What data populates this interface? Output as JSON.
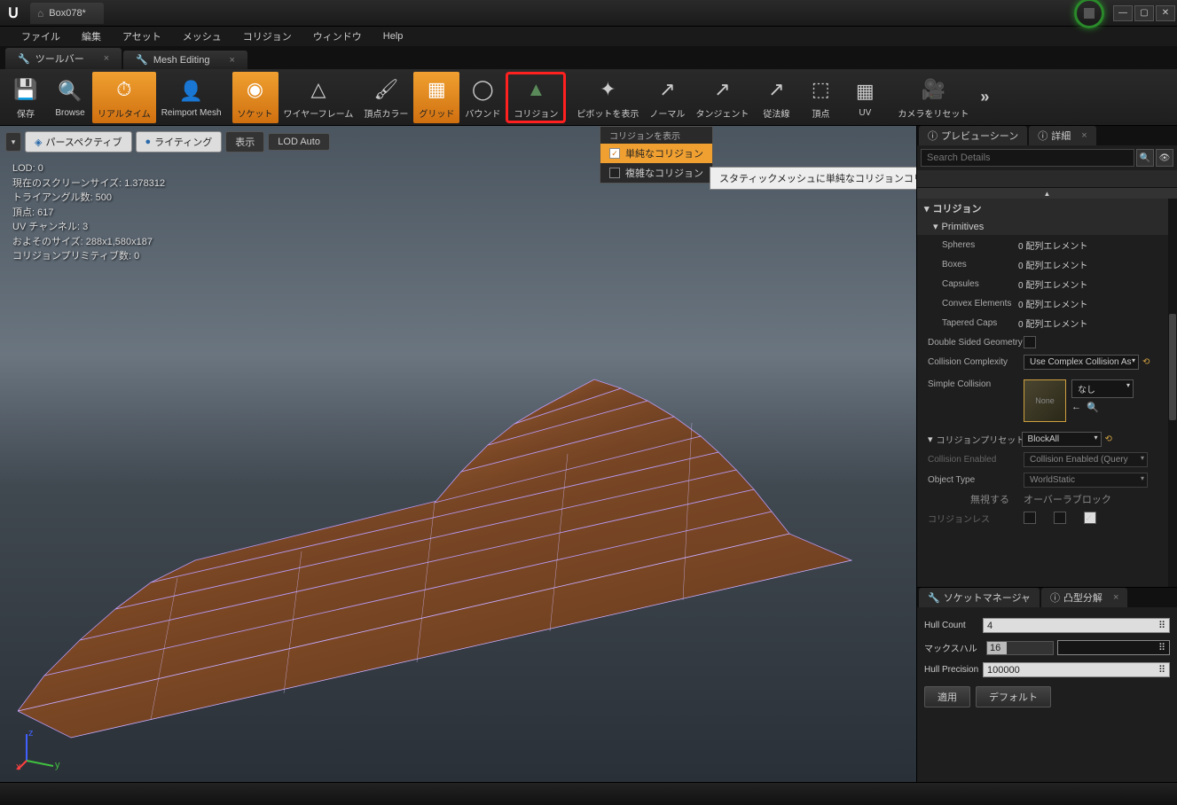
{
  "title": "Box078*",
  "menu": [
    "ファイル",
    "編集",
    "アセット",
    "メッシュ",
    "コリジョン",
    "ウィンドウ",
    "Help"
  ],
  "tabs": [
    {
      "icon": "✖",
      "label": "ツールバー"
    },
    {
      "icon": "✖",
      "label": "Mesh Editing"
    }
  ],
  "toolbar": [
    {
      "label": "保存",
      "active": false
    },
    {
      "label": "Browse",
      "active": false
    },
    {
      "label": "リアルタイム",
      "active": true
    },
    {
      "label": "Reimport Mesh",
      "active": false
    },
    {
      "label": "ソケット",
      "active": true
    },
    {
      "label": "ワイヤーフレーム",
      "active": false
    },
    {
      "label": "頂点カラー",
      "active": false
    },
    {
      "label": "グリッド",
      "active": true
    },
    {
      "label": "バウンド",
      "active": false
    },
    {
      "label": "コリジョン",
      "active": false,
      "highlight": true
    },
    {
      "label": "ピボットを表示",
      "active": false
    },
    {
      "label": "ノーマル",
      "active": false
    },
    {
      "label": "タンジェント",
      "active": false
    },
    {
      "label": "従法線",
      "active": false
    },
    {
      "label": "頂点",
      "active": false
    },
    {
      "label": "UV",
      "active": false
    },
    {
      "label": "カメラをリセット",
      "active": false
    }
  ],
  "viewport": {
    "pills": {
      "perspective": "パースペクティブ",
      "lit": "ライティング",
      "show": "表示",
      "lod": "LOD Auto"
    },
    "stats": [
      "LOD: 0",
      "現在のスクリーンサイズ: 1.378312",
      "トライアングル数: 500",
      "頂点: 617",
      "UV チャンネル: 3",
      "およそのサイズ: 288x1,580x187",
      "コリジョンプリミティブ数: 0"
    ]
  },
  "dropdown": {
    "title": "コリジョンを表示",
    "items": [
      {
        "label": "単純なコリジョン",
        "checked": true,
        "sel": true
      },
      {
        "label": "複雑なコリジョン",
        "checked": false,
        "sel": false
      }
    ]
  },
  "tooltip": "スタティックメッシュに単純なコリジョンコリジョンメッシュが割り当てられている場合に表示を切り替え",
  "rightTabs": {
    "preview": "プレビューシーン",
    "details": "詳細"
  },
  "searchPlaceholder": "Search Details",
  "collision": {
    "header": "コリジョン",
    "primHeader": "Primitives",
    "zeroArray": "0 配列エレメント",
    "rows": [
      "Spheres",
      "Boxes",
      "Capsules",
      "Convex Elements",
      "Tapered Caps"
    ],
    "doubleSided": "Double Sided Geometry",
    "complexity": {
      "label": "Collision Complexity",
      "value": "Use Complex Collision As"
    },
    "simple": {
      "label": "Simple Collision",
      "none": "None",
      "dd": "なし"
    },
    "preset": {
      "label": "コリジョンプリセット",
      "value": "BlockAll"
    },
    "enabled": {
      "label": "Collision Enabled",
      "value": "Collision Enabled (Query"
    },
    "objType": {
      "label": "Object Type",
      "value": "WorldStatic"
    },
    "responseHdr": {
      "ignore": "無視する",
      "overlap": "オーバーラブロック"
    },
    "responseRow": "コリジョンレス"
  },
  "bottomTabs": {
    "socket": "ソケットマネージャ",
    "convex": "凸型分解"
  },
  "convex": {
    "hullCount": {
      "label": "Hull Count",
      "value": "4"
    },
    "maxHull": {
      "label": "マックスハル",
      "value": "16"
    },
    "precision": {
      "label": "Hull Precision",
      "value": "100000"
    },
    "apply": "適用",
    "default": "デフォルト"
  }
}
